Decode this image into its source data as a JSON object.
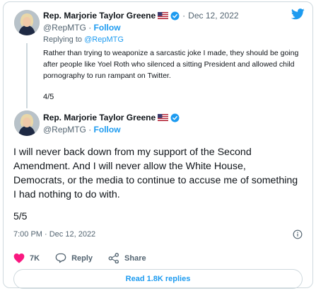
{
  "colors": {
    "accent": "#1d9bf0",
    "text": "#0f1419",
    "muted": "#536471",
    "border": "#cfd9de",
    "like": "#f91880"
  },
  "reply_tweet": {
    "author_name": "Rep. Marjorie Taylor Greene",
    "flag": "us-flag-icon",
    "verified": "verified-badge-icon",
    "dot": "·",
    "date": "Dec 12, 2022",
    "handle": "@RepMTG",
    "follow_dot": "·",
    "follow_label": "Follow",
    "replying_prefix": "Replying to",
    "replying_to": "@RepMTG",
    "text": "Rather than trying to weaponize a sarcastic joke I made, they should be going after people like Yoel Roth who silenced a sitting President and allowed child pornography to run rampant on Twitter.",
    "thread_count": "4/5"
  },
  "main_tweet": {
    "author_name": "Rep. Marjorie Taylor Greene",
    "flag": "us-flag-icon",
    "verified": "verified-badge-icon",
    "handle": "@RepMTG",
    "follow_dot": "·",
    "follow_label": "Follow",
    "text": "I will never back down from my support of the Second Amendment. And I will never allow the White House, Democrats, or the media to continue to accuse me of something I had nothing to do with.",
    "thread_count": "5/5",
    "timestamp": "7:00 PM · Dec 12, 2022",
    "likes": "7K",
    "reply_label": "Reply",
    "share_label": "Share",
    "read_replies": "Read 1.8K replies"
  },
  "icons": [
    "twitter-bird-icon",
    "info-icon",
    "heart-icon",
    "reply-bubble-icon",
    "share-icon"
  ]
}
